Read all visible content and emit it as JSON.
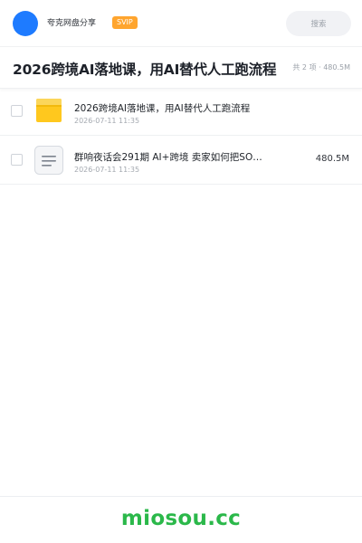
{
  "header": {
    "brand": "夸克网盘分享",
    "vip_badge": "SVIP",
    "search_label": "搜索",
    "colors": {
      "avatar": "#1e7bff",
      "vip": "#ffa52e"
    }
  },
  "share": {
    "title": "2026跨境AI落地课，用AI替代人工跑流程",
    "summary": "共 2 项 · 480.5M"
  },
  "files": [
    {
      "name": "2026跨境AI落地课，用AI替代人工跑流程",
      "date": "2026-07-11 11:35",
      "size": "",
      "icon": "folder-icon"
    },
    {
      "name": "群响夜话会291期  AI+跨境  卖家如何把SO…",
      "date": "2026-07-11 11:35",
      "size": "480.5M",
      "icon": "document-icon"
    }
  ],
  "footer": {
    "watermark": "miosou.cc",
    "watermark_color": "#2bb84a"
  }
}
